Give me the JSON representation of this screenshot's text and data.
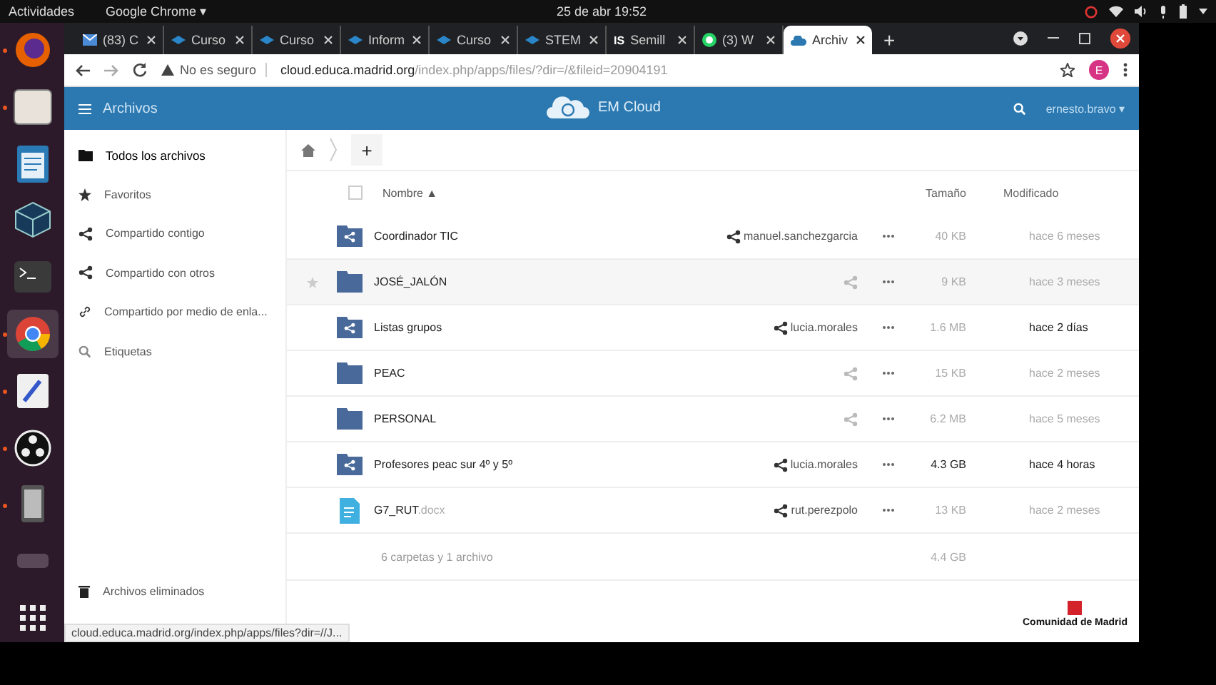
{
  "topbar": {
    "activities": "Actividades",
    "app_menu": "Google Chrome ▾",
    "clock": "25 de abr  19:52"
  },
  "dock": [
    {
      "kind": "firefox",
      "running": true
    },
    {
      "kind": "files",
      "running": true
    },
    {
      "kind": "writer",
      "running": false
    },
    {
      "kind": "cube",
      "running": false
    },
    {
      "kind": "terminal",
      "running": false
    },
    {
      "kind": "chrome",
      "running": true
    },
    {
      "kind": "editor",
      "running": true
    },
    {
      "kind": "obs",
      "running": true
    },
    {
      "kind": "tablet",
      "running": true
    },
    {
      "kind": "blank",
      "running": false
    },
    {
      "kind": "grid",
      "running": false
    }
  ],
  "browser": {
    "tabs": [
      {
        "kind": "mail",
        "label": "(83) C",
        "selected": false
      },
      {
        "kind": "cap",
        "label": "Curso",
        "selected": false
      },
      {
        "kind": "cap",
        "label": "Curso",
        "selected": false
      },
      {
        "kind": "cap",
        "label": "Inform",
        "selected": false
      },
      {
        "kind": "cap",
        "label": "Curso",
        "selected": false
      },
      {
        "kind": "cap",
        "label": "STEM",
        "selected": false
      },
      {
        "kind": "text",
        "label": "Semill",
        "selected": false,
        "icon_text": "IS"
      },
      {
        "kind": "chat",
        "label": "(3) W",
        "selected": false
      },
      {
        "kind": "cloud",
        "label": "Archiv",
        "selected": true
      }
    ],
    "new_tab": "+",
    "security": "No es seguro",
    "url_host": "cloud.educa.madrid.org",
    "url_path": "/index.php/apps/files/?dir=/&fileid=20904191",
    "profile": "E"
  },
  "app": {
    "title": "Archivos",
    "brand": "EM Cloud",
    "user": "ernesto.bravo ▾"
  },
  "sidebar": {
    "items": [
      {
        "kind": "folder",
        "label": "Todos los archivos",
        "selected": true
      },
      {
        "kind": "star",
        "label": "Favoritos",
        "selected": false
      },
      {
        "kind": "share",
        "label": "Compartido contigo",
        "selected": false
      },
      {
        "kind": "share",
        "label": "Compartido con otros",
        "selected": false
      },
      {
        "kind": "link",
        "label": "Compartido por medio de enla...",
        "selected": false
      },
      {
        "kind": "search",
        "label": "Etiquetas",
        "selected": false
      }
    ],
    "bottom_items": [
      {
        "kind": "trash",
        "label": "Archivos eliminados",
        "selected": false
      }
    ]
  },
  "breadcrumb": {
    "add": "+"
  },
  "table": {
    "select_all_checked": false,
    "columns": [
      "Nombre ▲",
      "Tamaño",
      "Modificado"
    ],
    "rows": [
      {
        "kind": "shared-folder",
        "name": "Coordinador TIC",
        "owner": "manuel.sanchezgarcia",
        "size": "40 KB",
        "modified": "hace 6 meses",
        "hovered": false,
        "size_highlight": false,
        "modified_highlight": false
      },
      {
        "kind": "folder",
        "name": "JOSÉ_JALÓN",
        "size": "9 KB",
        "modified": "hace 3 meses",
        "hovered": true,
        "size_highlight": false,
        "modified_highlight": false
      },
      {
        "kind": "shared-folder",
        "name": "Listas grupos",
        "owner": "lucia.morales",
        "size": "1.6 MB",
        "modified": "hace 2 días",
        "hovered": false,
        "size_highlight": false,
        "modified_highlight": true
      },
      {
        "kind": "folder",
        "name": "PEAC",
        "size": "15 KB",
        "modified": "hace 2 meses",
        "hovered": false,
        "size_highlight": false,
        "modified_highlight": false
      },
      {
        "kind": "folder",
        "name": "PERSONAL",
        "size": "6.2 MB",
        "modified": "hace 5 meses",
        "hovered": false,
        "size_highlight": false,
        "modified_highlight": false
      },
      {
        "kind": "shared-folder",
        "name": "Profesores peac sur 4º y 5º",
        "owner": "lucia.morales",
        "size": "4.3 GB",
        "modified": "hace 4 horas",
        "hovered": false,
        "size_highlight": true,
        "modified_highlight": true
      },
      {
        "kind": "document",
        "name": "G7_RUT",
        "extension": ".docx",
        "owner": "rut.perezpolo",
        "size": "13 KB",
        "modified": "hace 2 meses",
        "hovered": false,
        "size_highlight": false,
        "modified_highlight": false
      }
    ],
    "summary": "6 carpetas y 1 archivo",
    "total_size": "4.4 GB"
  },
  "footer_logo": "Comunidad de Madrid",
  "status_url": "cloud.educa.madrid.org/index.php/apps/files?dir=//J..."
}
